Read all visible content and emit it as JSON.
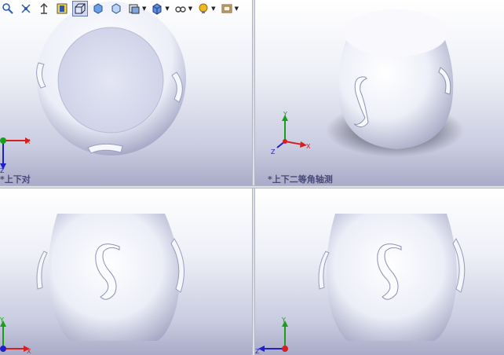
{
  "viewports": {
    "top_left": {
      "label": "*上下对"
    },
    "top_right": {
      "label": "*上下二等角轴测"
    }
  },
  "toolbar": {
    "buttons": [
      "zoom-icon",
      "pan-rotate-icon",
      "previous-view-icon",
      "section-view-icon",
      "view-orientation-icon",
      "shaded-icon",
      "hidden-lines-icon",
      "display-style-icon",
      "view-cube-icon",
      "edit-appearance-icon",
      "lights-icon",
      "scene-icon"
    ]
  },
  "axes": {
    "x": "X",
    "y": "Y",
    "z": "Z"
  },
  "colors": {
    "x_axis": "#d62020",
    "y_axis": "#18a018",
    "z_axis": "#2020c8",
    "model": "#e8eaf6"
  }
}
